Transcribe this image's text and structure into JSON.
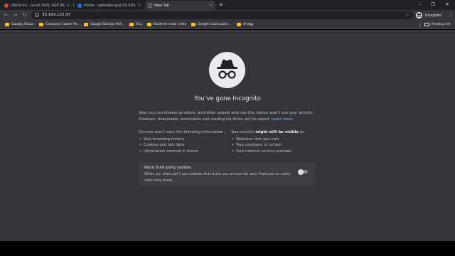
{
  "tabs": [
    {
      "title": "[TechCon - Level 200]: GKE Work",
      "fav_color": "#ea4335"
    },
    {
      "title": "Home - qwiklabs-gcp-01-593...",
      "fav_color": "#1a73e8"
    },
    {
      "title": "New Tab",
      "fav_color": ""
    }
  ],
  "new_tab_symbol": "+",
  "window_controls": {
    "minimize": "–",
    "maximize": "❐",
    "close": "✕"
  },
  "toolbar": {
    "back": "←",
    "forward": "→",
    "reload": "↻",
    "url": "35.193.122.97",
    "info_symbol": "i",
    "star": "☆",
    "profile_label": "Incognito",
    "menu": "⋮"
  },
  "bookmarks": [
    "Google_Cloud",
    "Company Career Pa...",
    "Google DevOps Ref...",
    "HCL",
    "Books to read, video",
    "Google cloud partn...",
    "Chegg"
  ],
  "reading_list": "Reading list",
  "page": {
    "heading": "You’ve gone Incognito",
    "intro_text": "Now you can browse privately, and other people who use this device won’t see your activity. However, downloads, bookmarks and reading list items will be saved.",
    "learn_more": "Learn more",
    "left_col": {
      "heading": "Chrome won’t save the following information:",
      "items": [
        "Your browsing history",
        "Cookies and site data",
        "Information entered in forms"
      ]
    },
    "right_col": {
      "heading_pre": "Your activity ",
      "heading_bold": "might still be visible",
      "heading_post": " to:",
      "items": [
        "Websites that you visit",
        "Your employer or school",
        "Your internet service provider"
      ]
    },
    "cookie_card": {
      "title": "Block third-party cookies",
      "description": "When on, sites can't use cookies that track you across the web. Features on some sites may break.",
      "toggle_on": false
    }
  },
  "colors": {
    "tabstrip": "#202124",
    "toolbar": "#35363a",
    "page_bg": "#35363a",
    "link": "#8ab4f8",
    "folder": "#fbc02d"
  }
}
